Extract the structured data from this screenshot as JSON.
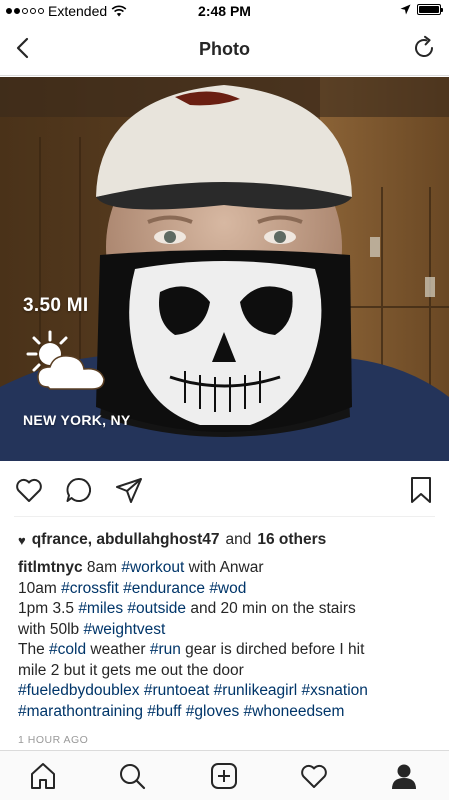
{
  "status_bar": {
    "carrier": "Extended",
    "time": "2:48 PM",
    "battery_level": 1.0
  },
  "nav": {
    "title": "Photo",
    "back_icon": "chevron-left-icon",
    "refresh_icon": "refresh-icon"
  },
  "photo": {
    "distance": "3.50 MI",
    "weather_icon": "partly-cloudy-icon",
    "location": "NEW YORK, NY"
  },
  "actions": {
    "like_icon": "heart-icon",
    "comment_icon": "comment-icon",
    "share_icon": "send-icon",
    "save_icon": "bookmark-icon"
  },
  "likes": {
    "names": "qfrance, abdullahghost47",
    "and": "and",
    "others": "16 others"
  },
  "caption": {
    "username": "fitlmtnyc",
    "l1_a": " 8am ",
    "l1_tag1": "#workout",
    "l1_b": " with Anwar",
    "l2_a": "10am ",
    "l2_tag1": "#crossfit",
    "l2_tag2": "#endurance",
    "l2_tag3": "#wod",
    "l3_a": "1pm 3.5 ",
    "l3_tag1": "#miles",
    "l3_tag2": "#outside",
    "l3_b": " and 20 min on the stairs",
    "l4_a": "with 50lb ",
    "l4_tag1": "#weightvest",
    "l5_a": "The ",
    "l5_tag1": "#cold",
    "l5_b": " weather ",
    "l5_tag2": "#run",
    "l5_c": " gear is dirched before I hit",
    "l6_a": "mile 2 but it gets me out the door",
    "l7_tag1": "#fueledbydoublex",
    "l7_tag2": "#runtoeat",
    "l7_tag3": "#runlikeagirl",
    "l7_tag4": "#xsnation",
    "l8_tag1": "#marathontraining",
    "l8_tag2": "#buff",
    "l8_tag3": "#gloves",
    "l8_tag4": "#whoneedsem"
  },
  "timestamp": "1 HOUR AGO",
  "tab_bar": {
    "home_icon": "home-icon",
    "search_icon": "search-icon",
    "add_icon": "add-post-icon",
    "activity_icon": "heart-icon",
    "profile_icon": "profile-icon"
  },
  "colors": {
    "hashtag": "#003569",
    "text": "#262626",
    "muted": "#999999",
    "divider": "#dbdbdb"
  }
}
